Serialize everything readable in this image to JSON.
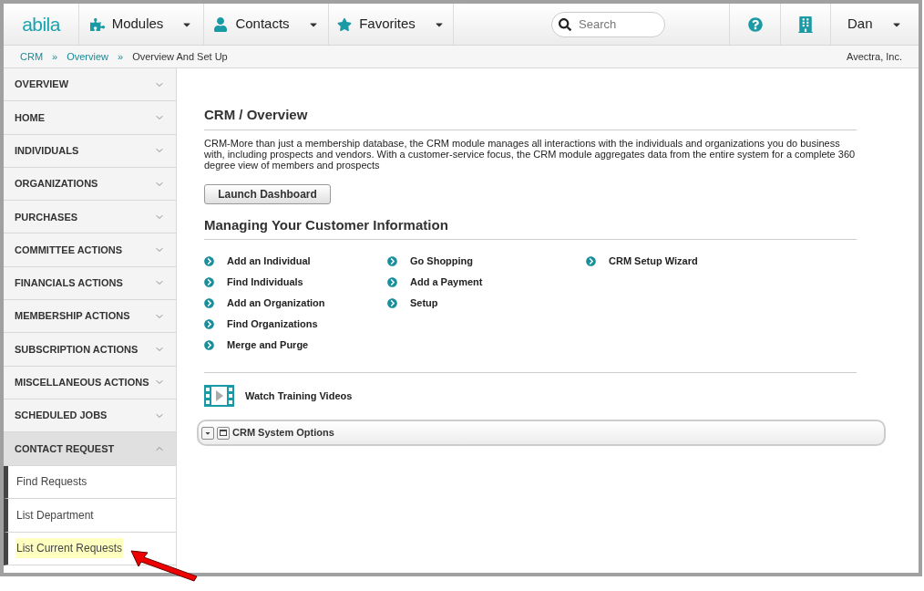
{
  "header": {
    "logo": "abila",
    "menus": [
      {
        "kind": "modules",
        "label": "Modules"
      },
      {
        "kind": "contacts",
        "label": "Contacts"
      },
      {
        "kind": "favorites",
        "label": "Favorites"
      }
    ],
    "search": {
      "placeholder": "Search"
    },
    "user": "Dan"
  },
  "breadcrumb": {
    "links": [
      "CRM",
      "Overview"
    ],
    "separator": "»",
    "current": "Overview And Set Up",
    "organization": "Avectra, Inc."
  },
  "sidebar": {
    "sections": [
      {
        "label": "OVERVIEW",
        "expanded": false
      },
      {
        "label": "HOME",
        "expanded": false
      },
      {
        "label": "INDIVIDUALS",
        "expanded": false
      },
      {
        "label": "ORGANIZATIONS",
        "expanded": false
      },
      {
        "label": "PURCHASES",
        "expanded": false
      },
      {
        "label": "COMMITTEE ACTIONS",
        "expanded": false
      },
      {
        "label": "FINANCIALS ACTIONS",
        "expanded": false
      },
      {
        "label": "MEMBERSHIP ACTIONS",
        "expanded": false
      },
      {
        "label": "SUBSCRIPTION ACTIONS",
        "expanded": false
      },
      {
        "label": "MISCELLANEOUS ACTIONS",
        "expanded": false
      },
      {
        "label": "SCHEDULED JOBS",
        "expanded": false
      },
      {
        "label": "CONTACT REQUEST",
        "expanded": true,
        "children": [
          {
            "label": "Find Requests",
            "highlighted": false
          },
          {
            "label": "List Department",
            "highlighted": false
          },
          {
            "label": "List Current Requests",
            "highlighted": true
          }
        ]
      }
    ]
  },
  "main": {
    "title": "CRM / Overview",
    "description": "CRM-More than just a membership database, the CRM module manages all interactions with the individuals and organizations you do business with, including prospects and vendors. With a customer-service focus, the CRM module aggregates data from the entire system for a complete 360 degree view of members and prospects",
    "button": "Launch Dashboard",
    "section_title": "Managing Your Customer Information",
    "link_columns": [
      [
        "Add an Individual",
        "Find Individuals",
        "Add an Organization",
        "Find Organizations",
        "Merge and Purge"
      ],
      [
        "Go Shopping",
        "Add a Payment",
        "Setup"
      ],
      [
        "CRM Setup Wizard"
      ]
    ],
    "video_link": "Watch Training Videos",
    "panel_title": "CRM System Options"
  }
}
